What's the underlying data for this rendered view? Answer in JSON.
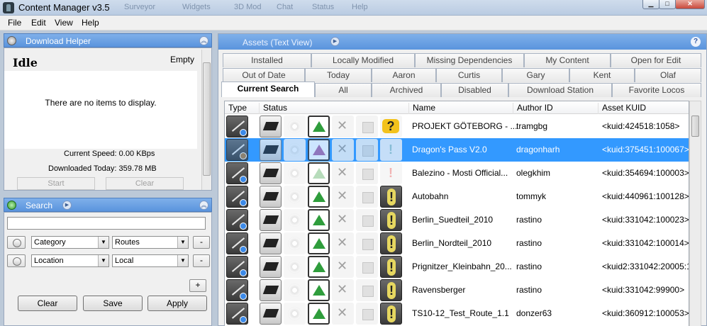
{
  "window": {
    "title": "Content Manager v3.5",
    "ghost_tabs": [
      "Surveyor",
      "Widgets",
      "3D Mod",
      "Chat",
      "Status",
      "Help"
    ]
  },
  "menu": [
    "File",
    "Edit",
    "View",
    "Help"
  ],
  "download_helper": {
    "title": "Download Helper",
    "status": "Idle",
    "queue_state": "Empty",
    "no_items": "There are no items to display.",
    "current_speed": "Current Speed: 0.00 KBps",
    "downloaded_today": "Downloaded Today: 359.78 MB",
    "start_label": "Start",
    "clear_label": "Clear"
  },
  "search": {
    "title": "Search",
    "query": "",
    "criteria": [
      {
        "field": "Category",
        "value": "Routes",
        "remove": "-"
      },
      {
        "field": "Location",
        "value": "Local",
        "remove": "-"
      }
    ],
    "add_label": "+",
    "clear_label": "Clear",
    "save_label": "Save",
    "apply_label": "Apply"
  },
  "assets": {
    "title": "Assets (Text View)",
    "help": "?",
    "tabs_row1": [
      "Installed",
      "Locally Modified",
      "Missing Dependencies",
      "My Content",
      "Open for Edit"
    ],
    "tabs_row2": [
      "Out of Date",
      "Today",
      "Aaron",
      "Curtis",
      "Gary",
      "Kent",
      "Olaf"
    ],
    "tabs_row3": [
      "Current Search",
      "All",
      "Archived",
      "Disabled",
      "Download Station",
      "Favorite Locos"
    ],
    "columns": [
      "Type",
      "Status",
      "Name",
      "Author ID",
      "Asset KUID"
    ],
    "rows": [
      {
        "name": "PROJEKT GÖTEBORG - ...",
        "author": "tramgbg",
        "kuid": "<kuid:424518:1058>",
        "selected": false,
        "warn": "question",
        "faded": false
      },
      {
        "name": "Dragon's Pass V2.0",
        "author": "dragonharh",
        "kuid": "<kuid:375451:100067>",
        "selected": true,
        "warn": "faint",
        "faded": false
      },
      {
        "name": "Balezino - Mosti Official...",
        "author": "olegkhim",
        "kuid": "<kuid:354694:100003>",
        "selected": false,
        "warn": "faint",
        "faded": true
      },
      {
        "name": "Autobahn",
        "author": "tommyk",
        "kuid": "<kuid:440961:100128>",
        "selected": false,
        "warn": "exclaim",
        "faded": false
      },
      {
        "name": "Berlin_Suedteil_2010",
        "author": "rastino",
        "kuid": "<kuid:331042:100023>",
        "selected": false,
        "warn": "exclaim",
        "faded": false
      },
      {
        "name": "Berlin_Nordteil_2010",
        "author": "rastino",
        "kuid": "<kuid:331042:100014>",
        "selected": false,
        "warn": "exclaim",
        "faded": false
      },
      {
        "name": "Prignitzer_Kleinbahn_20...",
        "author": "rastino",
        "kuid": "<kuid2:331042:20005:1",
        "selected": false,
        "warn": "exclaim",
        "faded": false
      },
      {
        "name": "Ravensberger",
        "author": "rastino",
        "kuid": "<kuid:331042:99900>",
        "selected": false,
        "warn": "exclaim",
        "faded": false
      },
      {
        "name": "TS10-12_Test_Route_1.1",
        "author": "donzer63",
        "kuid": "<kuid:360912:100053>",
        "selected": false,
        "warn": "exclaim",
        "faded": false
      }
    ]
  }
}
